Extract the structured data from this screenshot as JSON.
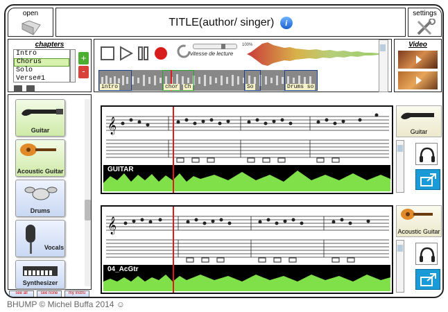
{
  "header": {
    "open_label": "open",
    "title": "TITLE(author/ singer)",
    "info_glyph": "i",
    "settings_label": "settings"
  },
  "chapters": {
    "title": "chapters",
    "items": [
      {
        "label": "Intro",
        "selected": false
      },
      {
        "label": "Chorus",
        "selected": true
      },
      {
        "label": "Solo",
        "selected": false
      },
      {
        "label": "Verse#1",
        "selected": false
      }
    ],
    "add_label": "+",
    "remove_label": "-"
  },
  "transport": {
    "speed_label": "vitesse de lecture",
    "speed_percent": "100%"
  },
  "overview": {
    "sections": [
      "intro",
      "chor",
      "Ch",
      "So",
      "Drums so"
    ]
  },
  "video": {
    "title": "Video"
  },
  "instruments": [
    {
      "label": "Guitar",
      "style": "green",
      "icon": "electric-guitar-icon"
    },
    {
      "label": "Acoustic Guitar",
      "style": "green",
      "icon": "acoustic-guitar-icon"
    },
    {
      "label": "Drums",
      "style": "blue",
      "icon": "drums-icon"
    },
    {
      "label": "Vocals",
      "style": "blue",
      "icon": "microphone-icon"
    },
    {
      "label": "Synthesizer",
      "style": "blue",
      "icon": "keyboard-icon"
    }
  ],
  "bottom_buttons": [
    {
      "label": "see all"
    },
    {
      "label": "see none"
    },
    {
      "label": "my instru"
    }
  ],
  "tracks": [
    {
      "wave_label": "GUITAR",
      "instrument_label": "Guitar"
    },
    {
      "wave_label": "04_AcGtr",
      "instrument_label": "Acoustic Guitar"
    }
  ],
  "footer": "BHUMP © Michel Buffa 2014 ☺",
  "colors": {
    "accent_green": "#4caf32",
    "wave_green": "#7fe04a",
    "cursor_red": "#e01a1a",
    "popout_blue": "#1a9ad6"
  }
}
